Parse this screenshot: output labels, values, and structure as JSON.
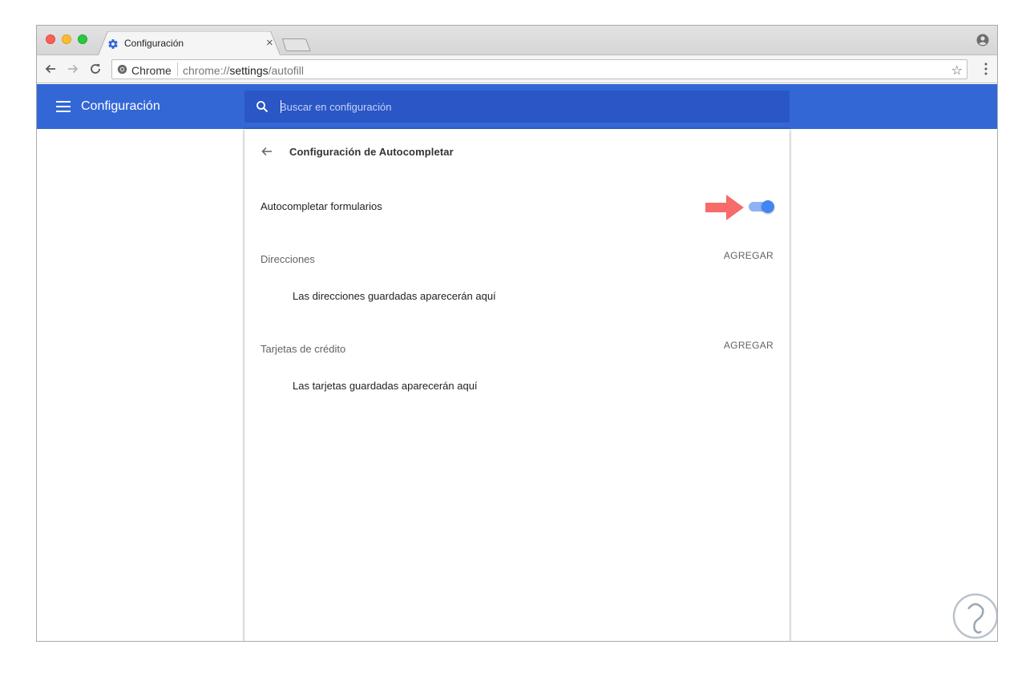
{
  "browser": {
    "tab": {
      "title": "Configuración"
    },
    "omnibox": {
      "scheme_label": "Chrome",
      "url_prefix": "chrome://",
      "url_host": "settings",
      "url_path": "/autofill"
    }
  },
  "header": {
    "title": "Configuración",
    "search_placeholder": "Buscar en configuración"
  },
  "page": {
    "title": "Configuración de Autocompletar",
    "autofill_toggle": {
      "label": "Autocompletar formularios",
      "enabled": true
    },
    "sections": [
      {
        "label": "Direcciones",
        "add_label": "AGREGAR",
        "empty_text": "Las direcciones guardadas aparecerán aquí"
      },
      {
        "label": "Tarjetas de crédito",
        "add_label": "AGREGAR",
        "empty_text": "Las tarjetas guardadas aparecerán aquí"
      }
    ]
  },
  "colors": {
    "header_bg": "#3367d6",
    "search_bg": "#2a56c6",
    "toggle_on": "#4285f4",
    "annotation_arrow": "#f76b6b"
  }
}
